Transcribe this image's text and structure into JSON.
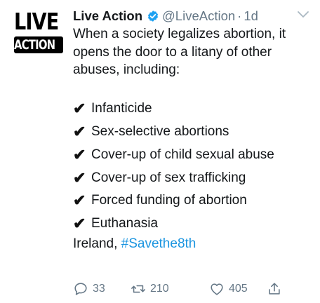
{
  "account": {
    "name": "Live Action",
    "handle": "@LiveAction",
    "separator": "·",
    "time": "1d",
    "logo_top": "LIVE",
    "logo_bottom": "ACTION"
  },
  "tweet": {
    "intro": "When a society legalizes abortion, it opens the door to a litany of other abuses, including:",
    "check_glyph": "✔",
    "items": [
      "Infanticide",
      "Sex-selective abortions",
      "Cover-up of child sexual abuse",
      "Cover-up of sex trafficking",
      "Forced funding of abortion",
      "Euthanasia"
    ],
    "closing_text": "Ireland, ",
    "hashtag": "#Savethe8th"
  },
  "actions": {
    "replies": "33",
    "retweets": "210",
    "likes": "405"
  },
  "colors": {
    "text": "#14171a",
    "muted": "#657786",
    "link": "#1b95e0",
    "verified": "#1da1f2"
  }
}
